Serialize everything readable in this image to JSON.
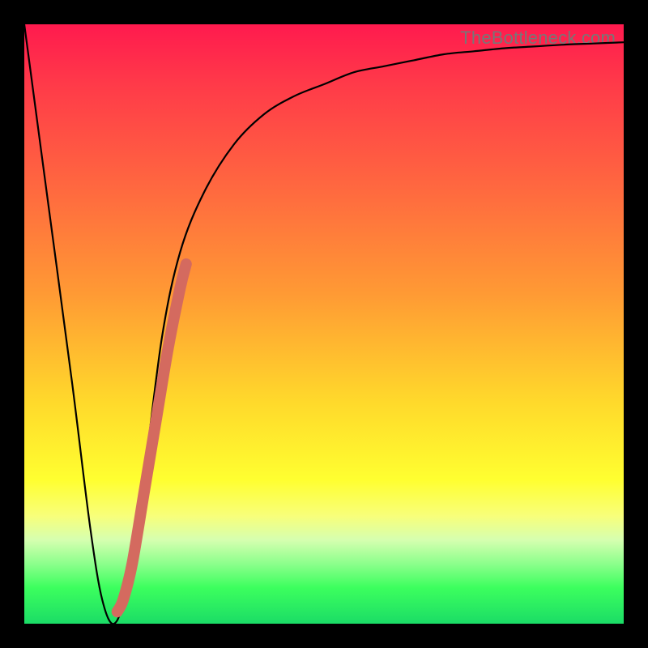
{
  "watermark": "TheBottleneck.com",
  "chart_data": {
    "type": "line",
    "title": "",
    "xlabel": "",
    "ylabel": "",
    "xlim": [
      0,
      100
    ],
    "ylim": [
      0,
      100
    ],
    "series": [
      {
        "name": "curve",
        "x": [
          0,
          4,
          8,
          11,
          13,
          15,
          17,
          20,
          23,
          26,
          30,
          35,
          40,
          45,
          50,
          55,
          60,
          65,
          70,
          75,
          80,
          85,
          90,
          95,
          100
        ],
        "y": [
          100,
          70,
          40,
          16,
          4,
          0,
          6,
          25,
          48,
          62,
          72,
          80,
          85,
          88,
          90,
          92,
          93,
          94,
          95,
          95.5,
          96,
          96.3,
          96.6,
          96.8,
          97
        ]
      },
      {
        "name": "highlight",
        "x": [
          15.5,
          16.5,
          18,
          20,
          22,
          24,
          26,
          27
        ],
        "y": [
          2,
          4,
          10,
          22,
          34,
          46,
          56,
          60
        ]
      }
    ],
    "colors": {
      "curve": "#000000",
      "highlight": "#d46a5f"
    }
  }
}
